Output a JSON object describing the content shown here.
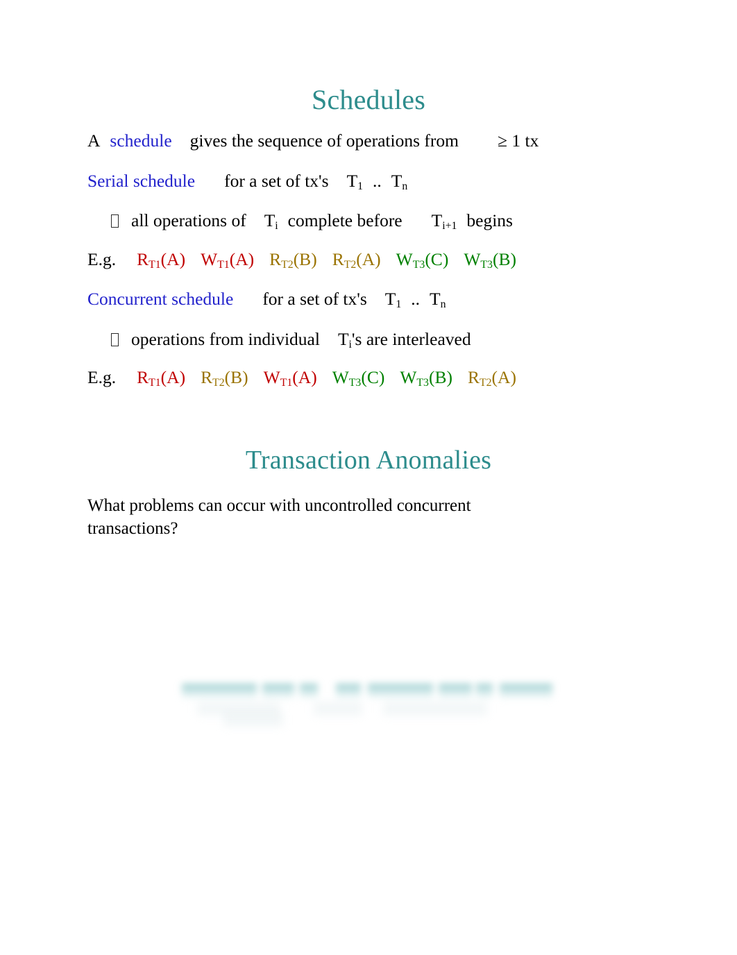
{
  "document": {
    "background_color": "#ffffff",
    "title_color": "#2d8c8c",
    "keyword_color": "#2222cc",
    "t1_color": "#c00000",
    "t2_color": "#9a7302",
    "t3_color": "#008000"
  },
  "headings": {
    "schedules": "Schedules",
    "anomalies": "Transaction Anomalies"
  },
  "line1": {
    "prefix": "A",
    "keyword": "schedule",
    "text": "gives the sequence of operations from",
    "suffix": "≥ 1  tx"
  },
  "line2": {
    "keyword": "Serial schedule",
    "text": "for a set of tx's",
    "t_first": "T",
    "t_first_sub": "1",
    "range": "..",
    "t_last": "T",
    "t_last_sub": "n"
  },
  "bullet1": {
    "glyph": "missing-char-box",
    "part1": "all operations of",
    "t_a": "T",
    "t_a_sub": "i",
    "part2": "complete before",
    "t_b": "T",
    "t_b_sub": "i+1",
    "part3": "begins"
  },
  "example1": {
    "label": "E.g.",
    "operations": [
      {
        "op": "R",
        "tx": "T1",
        "item": "A",
        "color_key": "t1"
      },
      {
        "op": "W",
        "tx": "T1",
        "item": "A",
        "color_key": "t1"
      },
      {
        "op": "R",
        "tx": "T2",
        "item": "B",
        "color_key": "t2"
      },
      {
        "op": "R",
        "tx": "T2",
        "item": "A",
        "color_key": "t2"
      },
      {
        "op": "W",
        "tx": "T3",
        "item": "C",
        "color_key": "t3"
      },
      {
        "op": "W",
        "tx": "T3",
        "item": "B",
        "color_key": "t3"
      }
    ]
  },
  "line3": {
    "keyword": "Concurrent schedule",
    "text": "for a set of tx's",
    "t_first": "T",
    "t_first_sub": "1",
    "range": "..",
    "t_last": "T",
    "t_last_sub": "n"
  },
  "bullet2": {
    "glyph": "missing-char-box",
    "part1": "operations from individual",
    "t_a": "T",
    "t_a_sub": "i",
    "part2": "'s are interleaved"
  },
  "example2": {
    "label": "E.g.",
    "operations": [
      {
        "op": "R",
        "tx": "T1",
        "item": "A",
        "color_key": "t1"
      },
      {
        "op": "R",
        "tx": "T2",
        "item": "B",
        "color_key": "t2"
      },
      {
        "op": "W",
        "tx": "T1",
        "item": "A",
        "color_key": "t1"
      },
      {
        "op": "W",
        "tx": "T3",
        "item": "C",
        "color_key": "t3"
      },
      {
        "op": "W",
        "tx": "T3",
        "item": "B",
        "color_key": "t3"
      },
      {
        "op": "R",
        "tx": "T2",
        "item": "A",
        "color_key": "t2"
      }
    ]
  },
  "question": {
    "text": "What problems can occur with uncontrolled concurrent transactions?"
  }
}
